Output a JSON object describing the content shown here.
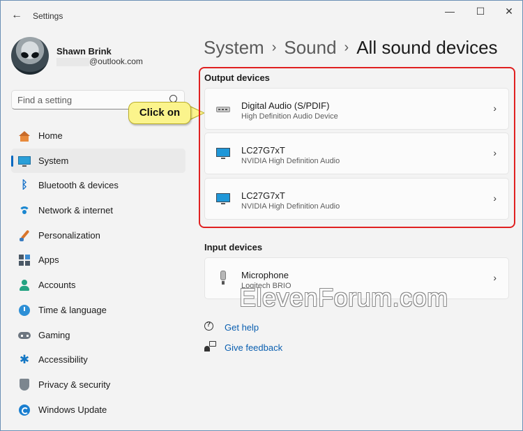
{
  "window": {
    "title": "Settings",
    "back": "←",
    "minimize": "—",
    "maximize": "☐",
    "close": "✕"
  },
  "profile": {
    "name": "Shawn Brink",
    "email": "@outlook.com"
  },
  "search": {
    "placeholder": "Find a setting"
  },
  "callout": {
    "text": "Click on"
  },
  "nav": {
    "items": [
      {
        "label": "Home",
        "icon": "home-icon"
      },
      {
        "label": "System",
        "icon": "system-icon",
        "selected": true
      },
      {
        "label": "Bluetooth & devices",
        "icon": "bluetooth-icon"
      },
      {
        "label": "Network & internet",
        "icon": "wifi-icon"
      },
      {
        "label": "Personalization",
        "icon": "brush-icon"
      },
      {
        "label": "Apps",
        "icon": "apps-icon"
      },
      {
        "label": "Accounts",
        "icon": "account-icon"
      },
      {
        "label": "Time & language",
        "icon": "clock-globe-icon"
      },
      {
        "label": "Gaming",
        "icon": "gamepad-icon"
      },
      {
        "label": "Accessibility",
        "icon": "accessibility-icon"
      },
      {
        "label": "Privacy & security",
        "icon": "shield-icon"
      },
      {
        "label": "Windows Update",
        "icon": "update-icon"
      }
    ]
  },
  "breadcrumb": {
    "items": [
      "System",
      "Sound"
    ],
    "current": "All sound devices",
    "separator": "›"
  },
  "output": {
    "title": "Output devices",
    "devices": [
      {
        "name": "Digital Audio (S/PDIF)",
        "sub": "High Definition Audio Device",
        "icon": "spdif-icon"
      },
      {
        "name": "LC27G7xT",
        "sub": "NVIDIA High Definition Audio",
        "icon": "monitor-icon"
      },
      {
        "name": "LC27G7xT",
        "sub": "NVIDIA High Definition Audio",
        "icon": "monitor-icon"
      }
    ]
  },
  "input": {
    "title": "Input devices",
    "devices": [
      {
        "name": "Microphone",
        "sub": "Logitech BRIO",
        "icon": "microphone-icon"
      }
    ]
  },
  "chevron": "›",
  "watermark": "ElevenForum.com",
  "links": {
    "help": "Get help",
    "feedback": "Give feedback"
  },
  "colors": {
    "accent": "#0067c0",
    "highlight_border": "#e02020",
    "callout_fill": "#fbf48c"
  }
}
